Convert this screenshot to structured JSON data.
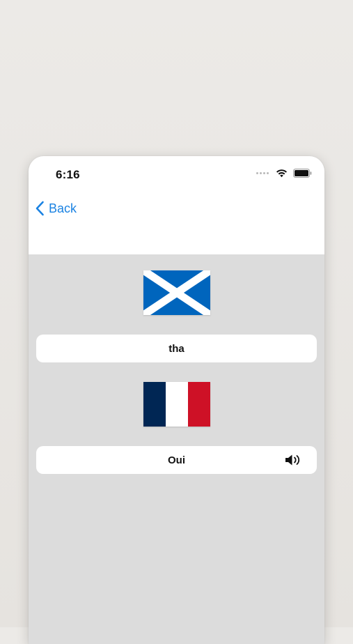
{
  "status_bar": {
    "time": "6:16",
    "icons": [
      "cellular-dots-icon",
      "wifi-icon",
      "battery-icon"
    ]
  },
  "nav": {
    "back_label": "Back",
    "accent_color": "#1a82e2"
  },
  "source": {
    "flag": "scotland-flag",
    "word": "tha"
  },
  "target": {
    "flag": "france-flag",
    "word": "Oui",
    "audio_icon": "speaker-icon"
  },
  "colors": {
    "background": "#dcdcdc",
    "card": "#ffffff",
    "scotland_blue": "#0065bd",
    "france_blue": "#002654",
    "france_red": "#ce1126"
  }
}
